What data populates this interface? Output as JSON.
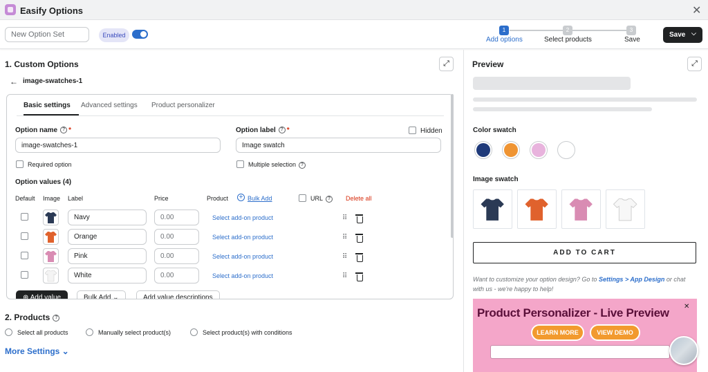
{
  "app": {
    "title": "Easify Options"
  },
  "toolbar": {
    "option_set_placeholder": "New Option Set",
    "enabled_label": "Enabled",
    "steps": [
      {
        "num": "1",
        "label": "Add options"
      },
      {
        "num": "2",
        "label": "Select products"
      },
      {
        "num": "3",
        "label": "Save"
      }
    ],
    "save_label": "Save"
  },
  "custom_options": {
    "heading": "1. Custom Options",
    "back_title": "image-swatches-1",
    "tabs": [
      "Basic settings",
      "Advanced settings",
      "Product personalizer"
    ],
    "option_name_label": "Option name",
    "option_name_value": "image-swatches-1",
    "option_label_label": "Option label",
    "option_label_value": "Image swatch",
    "hidden_label": "Hidden",
    "required_label": "Required option",
    "multiple_label": "Multiple selection",
    "values_heading": "Option values (4)",
    "columns": {
      "default": "Default",
      "image": "Image",
      "label": "Label",
      "price": "Price",
      "product": "Product",
      "bulk_add": "Bulk Add",
      "url": "URL",
      "delete_all": "Delete all"
    },
    "rows": [
      {
        "label": "Navy",
        "price": "0.00",
        "product": "Select add-on product",
        "color": "#2b3a55"
      },
      {
        "label": "Orange",
        "price": "0.00",
        "product": "Select add-on product",
        "color": "#e0622d"
      },
      {
        "label": "Pink",
        "price": "0.00",
        "product": "Select add-on product",
        "color": "#d98cb3"
      },
      {
        "label": "White",
        "price": "0.00",
        "product": "Select add-on product",
        "color": "#f4f4f4"
      }
    ],
    "add_value": "Add value",
    "bulk_add_btn": "Bulk Add",
    "add_desc": "Add value descriptions"
  },
  "products": {
    "heading": "2. Products",
    "options": [
      "Select all products",
      "Manually select product(s)",
      "Select product(s) with conditions"
    ]
  },
  "more_settings": "More Settings",
  "preview": {
    "heading": "Preview",
    "color_swatch_label": "Color swatch",
    "swatch_colors": [
      "#1f3a7a",
      "#ef9433",
      "#e8b3dd",
      "#ffffff"
    ],
    "image_swatch_label": "Image swatch",
    "add_to_cart": "ADD TO CART",
    "note_prefix": "Want to customize your option design? Go to ",
    "note_link": "Settings > App Design",
    "note_suffix": " or chat with us - we're happy to help!",
    "banner_title": "Product Personalizer - Live Preview",
    "learn_more": "LEARN MORE",
    "view_demo": "VIEW DEMO"
  }
}
